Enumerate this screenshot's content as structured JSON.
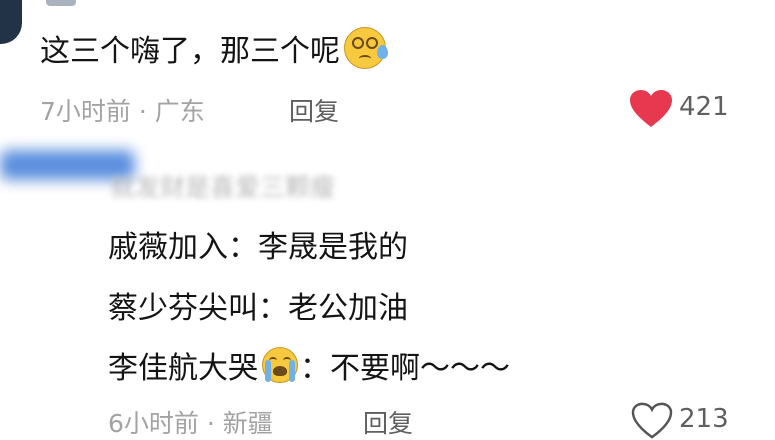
{
  "comment1": {
    "text": "这三个嗨了，那三个呢",
    "emoji": "dizzy-sweat-face",
    "time": "7小时前",
    "location": "广东",
    "reply_label": "回复",
    "likes": "421",
    "liked": true,
    "like_color": "#e8384f"
  },
  "comment2": {
    "lines": [
      "戚薇加入：李晟是我的",
      "蔡少芬尖叫：老公加油",
      "李佳航大哭",
      "：不要啊～～～"
    ],
    "emoji": "loudly-crying-face",
    "time": "6小时前",
    "location": "新疆",
    "reply_label": "回复",
    "likes": "213",
    "liked": false
  },
  "separator": "·"
}
